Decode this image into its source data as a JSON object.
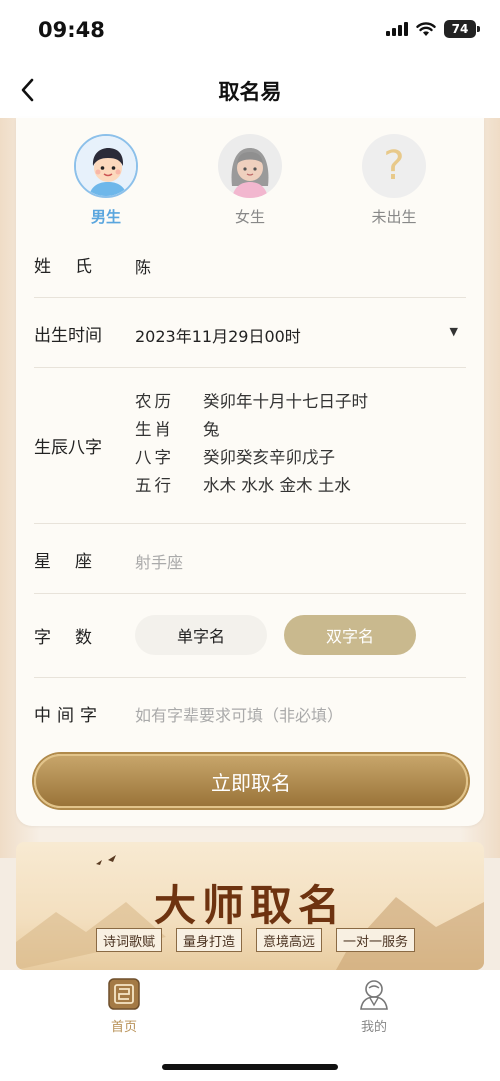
{
  "status_bar": {
    "time": "09:48",
    "battery": "74"
  },
  "nav": {
    "title": "取名易"
  },
  "gender": {
    "male": "男生",
    "female": "女生",
    "unborn": "未出生",
    "unborn_glyph": "?"
  },
  "surname": {
    "label": "姓氏",
    "value": "陈"
  },
  "birth": {
    "label": "出生时间",
    "value": "2023年11月29日00时",
    "arrow": "▼"
  },
  "bazi": {
    "label": "生辰八字",
    "lines": [
      {
        "k": "农历",
        "v": "癸卯年十月十七日子时"
      },
      {
        "k": "生肖",
        "v": "兔"
      },
      {
        "k": "八字",
        "v": "癸卯癸亥辛卯戊子"
      },
      {
        "k": "五行",
        "v": "水木 水水 金木 土水"
      }
    ]
  },
  "zodiac": {
    "label": "星座",
    "value": "射手座"
  },
  "name_length": {
    "label": "字数",
    "single": "单字名",
    "double": "双字名",
    "selected": "double"
  },
  "middle_char": {
    "label": "中间字",
    "placeholder": "如有字辈要求可填（非必填）"
  },
  "submit": {
    "label": "立即取名"
  },
  "banner": {
    "title": "大师取名",
    "tags": [
      "诗词歌赋",
      "量身打造",
      "意境高远",
      "一对一服务"
    ]
  },
  "tabs": {
    "home": "首页",
    "mine": "我的"
  },
  "colors": {
    "accent_gold": "#b9935a",
    "male_blue": "#5aa6de",
    "selected_pill": "#c9b98e"
  }
}
